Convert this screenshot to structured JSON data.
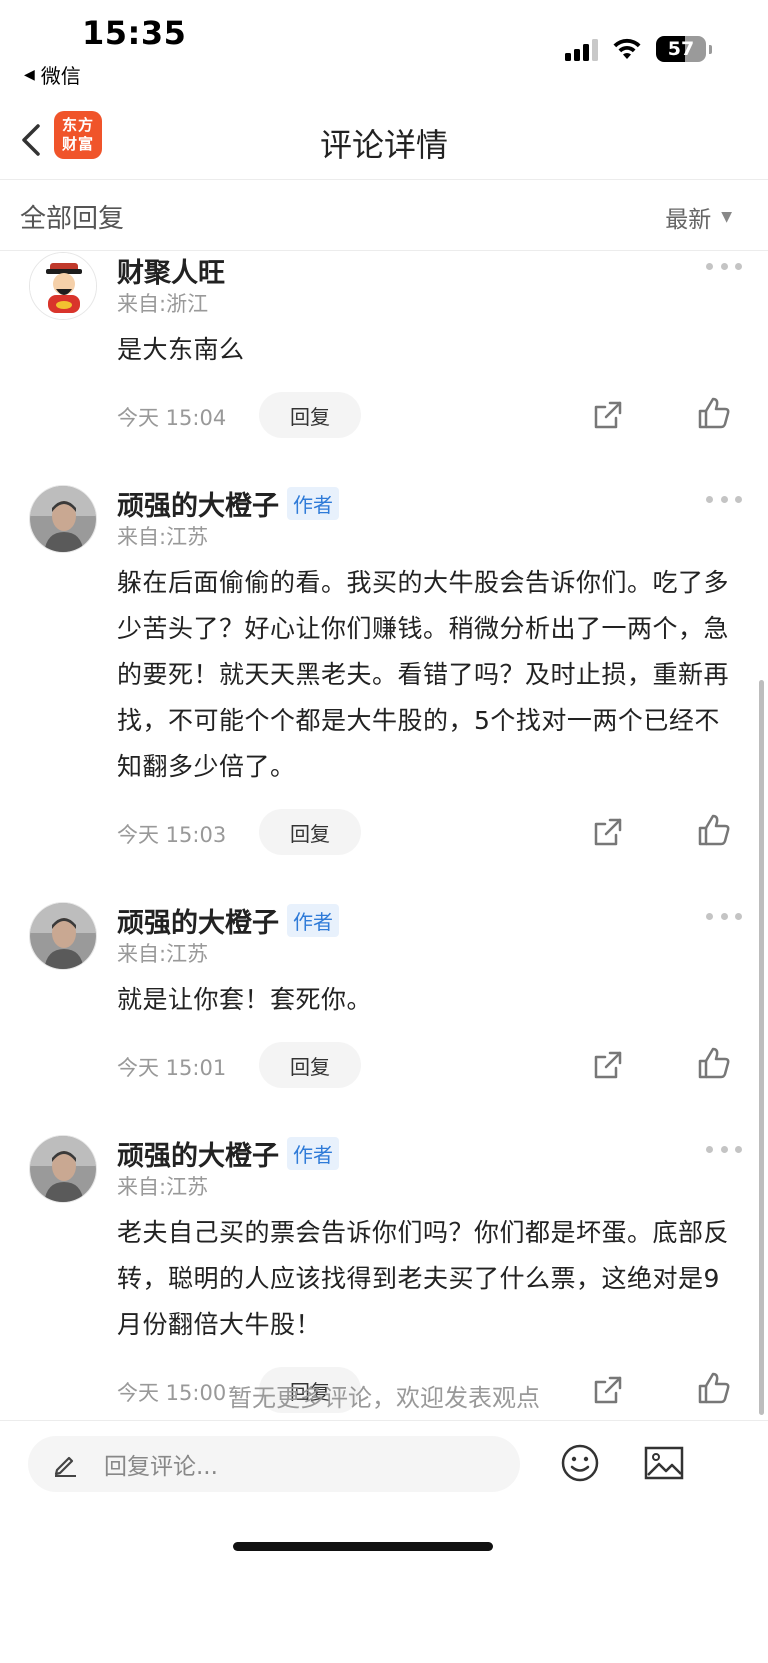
{
  "status_bar": {
    "time": "15:35",
    "back_app": "微信",
    "battery": "57",
    "battery_level": 0.57
  },
  "nav": {
    "logo_line1": "东方",
    "logo_line2": "财富",
    "title": "评论详情"
  },
  "section": {
    "title": "全部回复",
    "sort_label": "最新"
  },
  "comments": [
    {
      "name": "财聚人旺",
      "badge": "",
      "location": "来自:浙江",
      "text": "是大东南么",
      "time": "今天 15:04",
      "reply_label": "回复"
    },
    {
      "name": "顽强的大橙子",
      "badge": "作者",
      "location": "来自:江苏",
      "text": "躲在后面偷偷的看。我买的大牛股会告诉你们。吃了多少苦头了？好心让你们赚钱。稍微分析出了一两个，急的要死！就天天黑老夫。看错了吗？及时止损，重新再找，不可能个个都是大牛股的，5个找对一两个已经不知翻多少倍了。",
      "time": "今天 15:03",
      "reply_label": "回复"
    },
    {
      "name": "顽强的大橙子",
      "badge": "作者",
      "location": "来自:江苏",
      "text": "就是让你套！套死你。",
      "time": "今天 15:01",
      "reply_label": "回复"
    },
    {
      "name": "顽强的大橙子",
      "badge": "作者",
      "location": "来自:江苏",
      "text": "老夫自己买的票会告诉你们吗？你们都是坏蛋。底部反转，聪明的人应该找得到老夫买了什么票，这绝对是9月份翻倍大牛股！",
      "time": "今天 15:00",
      "reply_label": "回复"
    }
  ],
  "footer_note": "暂无更多评论，欢迎发表观点",
  "bottom_bar": {
    "placeholder": "回复评论..."
  },
  "colors": {
    "brand": "#f0542a",
    "badge_bg": "#e8f1fc",
    "badge_text": "#2f7bd8"
  }
}
